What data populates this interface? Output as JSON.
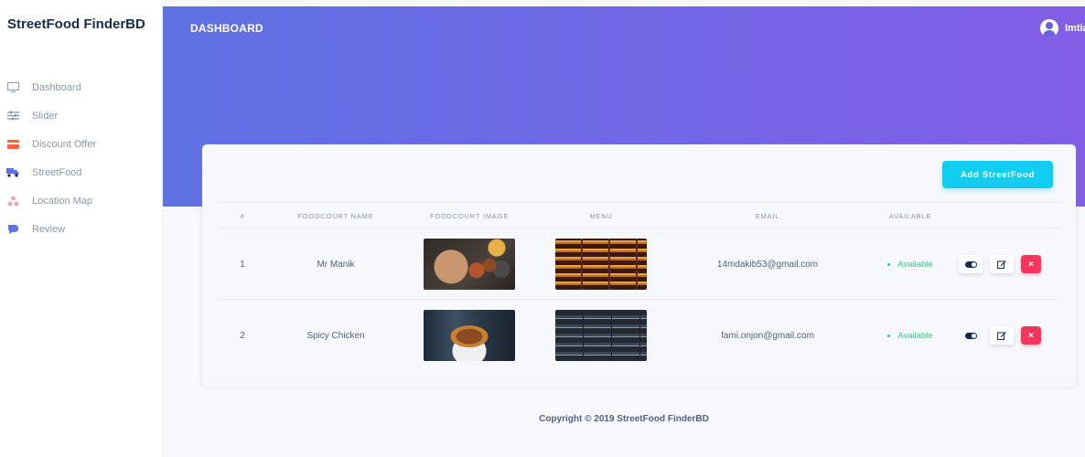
{
  "sidebar": {
    "brand": "StreetFood FinderBD",
    "items": [
      {
        "label": "Dashboard",
        "icon": "monitor-icon"
      },
      {
        "label": "Slider",
        "icon": "sliders-icon"
      },
      {
        "label": "Discount Offer",
        "icon": "credit-card-icon"
      },
      {
        "label": "StreetFood",
        "icon": "delivery-truck-icon"
      },
      {
        "label": "Location Map",
        "icon": "map-pin-icon"
      },
      {
        "label": "Review",
        "icon": "chat-icon"
      }
    ]
  },
  "header": {
    "title": "DASHBOARD",
    "user_name": "Imtiaz"
  },
  "card": {
    "add_button": "Add StreetFood",
    "columns": [
      "#",
      "FOODCOURT NAME",
      "FOODCOURT IMAGE",
      "MENU",
      "EMAIL",
      "AVAILABLE"
    ],
    "rows": [
      {
        "num": "1",
        "name": "Mr Manik",
        "email": "14mdakib53@gmail.com",
        "available": "Available"
      },
      {
        "num": "2",
        "name": "Spicy Chicken",
        "email": "fami.onjon@gmail.com",
        "available": "Available"
      }
    ]
  },
  "footer": {
    "copyright": "Copyright © 2019 ",
    "brand": "StreetFood FinderBD"
  },
  "colors": {
    "header_gradient_start": "#5e72e4",
    "header_gradient_end": "#825ee4",
    "add_button": "#11cdef",
    "available": "#2dce89",
    "delete": "#f5365c"
  }
}
